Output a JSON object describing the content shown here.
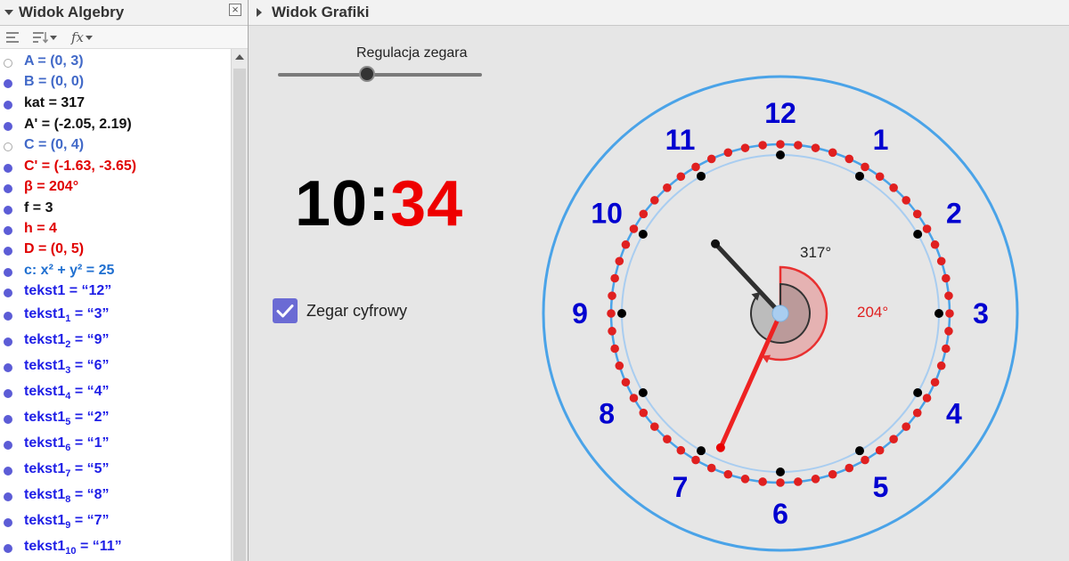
{
  "algebra_view": {
    "title": "Widok Algebry",
    "items": [
      {
        "pre": "A = (0, 3)",
        "sub": "",
        "post": "",
        "color": "blue",
        "visible": false
      },
      {
        "pre": "B = (0, 0)",
        "sub": "",
        "post": "",
        "color": "blue",
        "visible": true
      },
      {
        "pre": "kat = 317",
        "sub": "",
        "post": "",
        "color": "black",
        "visible": true
      },
      {
        "pre": "A' = (-2.05, 2.19)",
        "sub": "",
        "post": "",
        "color": "black",
        "visible": true
      },
      {
        "pre": "C = (0, 4)",
        "sub": "",
        "post": "",
        "color": "blue",
        "visible": false
      },
      {
        "pre": "C' = (-1.63, -3.65)",
        "sub": "",
        "post": "",
        "color": "red",
        "visible": true
      },
      {
        "pre": "β = 204°",
        "sub": "",
        "post": "",
        "color": "red",
        "visible": true
      },
      {
        "pre": "f = 3",
        "sub": "",
        "post": "",
        "color": "black",
        "visible": true
      },
      {
        "pre": "h = 4",
        "sub": "",
        "post": "",
        "color": "red",
        "visible": true
      },
      {
        "pre": "D = (0, 5)",
        "sub": "",
        "post": "",
        "color": "red",
        "visible": true
      },
      {
        "pre": "c: x² + y² = 25",
        "sub": "",
        "post": "",
        "color": "sky",
        "visible": true
      },
      {
        "pre": "tekst1 = “12”",
        "sub": "",
        "post": "",
        "color": "navy",
        "visible": true
      },
      {
        "pre": "tekst1",
        "sub": "1",
        "post": " = “3”",
        "color": "navy",
        "visible": true
      },
      {
        "pre": "tekst1",
        "sub": "2",
        "post": " = “9”",
        "color": "navy",
        "visible": true
      },
      {
        "pre": "tekst1",
        "sub": "3",
        "post": " = “6”",
        "color": "navy",
        "visible": true
      },
      {
        "pre": "tekst1",
        "sub": "4",
        "post": " = “4”",
        "color": "navy",
        "visible": true
      },
      {
        "pre": "tekst1",
        "sub": "5",
        "post": " = “2”",
        "color": "navy",
        "visible": true
      },
      {
        "pre": "tekst1",
        "sub": "6",
        "post": " = “1”",
        "color": "navy",
        "visible": true
      },
      {
        "pre": "tekst1",
        "sub": "7",
        "post": " = “5”",
        "color": "navy",
        "visible": true
      },
      {
        "pre": "tekst1",
        "sub": "8",
        "post": " = “8”",
        "color": "navy",
        "visible": true
      },
      {
        "pre": "tekst1",
        "sub": "9",
        "post": " = “7”",
        "color": "navy",
        "visible": true
      },
      {
        "pre": "tekst1",
        "sub": "10",
        "post": " = “11”",
        "color": "navy",
        "visible": true
      }
    ]
  },
  "graphics_view": {
    "title": "Widok Grafiki",
    "slider": {
      "label": "Regulacja zegara",
      "value_fraction": 0.43
    },
    "digital": {
      "hours": "10",
      "separator": ":",
      "minutes": "34"
    },
    "checkbox": {
      "label": "Zegar cyfrowy",
      "checked": true
    },
    "clock": {
      "numbers": [
        "12",
        "1",
        "2",
        "3",
        "4",
        "5",
        "6",
        "7",
        "8",
        "9",
        "10",
        "11"
      ],
      "angle_hour_label": "317°",
      "angle_minute_label": "204°",
      "hour_hand_angle_deg": 317,
      "minute_hand_angle_deg": 204,
      "colors": {
        "numbers": "#0000d0",
        "outer_circle": "#4aa3e8",
        "inner_circle": "#a9cdf0",
        "minute_dots": "#e02020",
        "hour_hand": "#2f2f2f",
        "minute_hand": "#ee2222",
        "center": "#a9cdf0"
      }
    }
  },
  "colors": {
    "blue": "#4169c8",
    "navy": "#1e1ee6",
    "black": "#111111",
    "red": "#e00000",
    "sky": "#1f6fd0"
  }
}
